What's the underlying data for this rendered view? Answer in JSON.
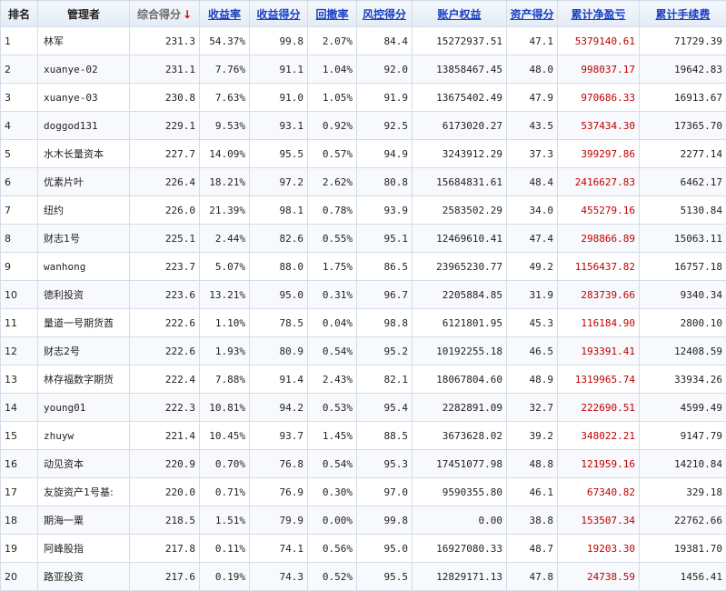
{
  "headers": {
    "rank": "排名",
    "manager": "管理者",
    "score": "综合得分",
    "return_rate": "收益率",
    "return_score": "收益得分",
    "drawdown": "回撤率",
    "risk_score": "风控得分",
    "equity": "账户权益",
    "asset_score": "资产得分",
    "net_pnl": "累计净盈亏",
    "fees": "累计手续费",
    "sort_arrow": "↓"
  },
  "rows": [
    {
      "rank": "1",
      "manager": "林军",
      "score": "231.3",
      "return_rate": "54.37%",
      "return_score": "99.8",
      "drawdown": "2.07%",
      "risk_score": "84.4",
      "equity": "15272937.51",
      "asset_score": "47.1",
      "net_pnl": "5379140.61",
      "fees": "71729.39"
    },
    {
      "rank": "2",
      "manager": "xuanye-02",
      "score": "231.1",
      "return_rate": "7.76%",
      "return_score": "91.1",
      "drawdown": "1.04%",
      "risk_score": "92.0",
      "equity": "13858467.45",
      "asset_score": "48.0",
      "net_pnl": "998037.17",
      "fees": "19642.83"
    },
    {
      "rank": "3",
      "manager": "xuanye-03",
      "score": "230.8",
      "return_rate": "7.63%",
      "return_score": "91.0",
      "drawdown": "1.05%",
      "risk_score": "91.9",
      "equity": "13675402.49",
      "asset_score": "47.9",
      "net_pnl": "970686.33",
      "fees": "16913.67"
    },
    {
      "rank": "4",
      "manager": "doggod131",
      "score": "229.1",
      "return_rate": "9.53%",
      "return_score": "93.1",
      "drawdown": "0.92%",
      "risk_score": "92.5",
      "equity": "6173020.27",
      "asset_score": "43.5",
      "net_pnl": "537434.30",
      "fees": "17365.70"
    },
    {
      "rank": "5",
      "manager": "水木长量资本",
      "score": "227.7",
      "return_rate": "14.09%",
      "return_score": "95.5",
      "drawdown": "0.57%",
      "risk_score": "94.9",
      "equity": "3243912.29",
      "asset_score": "37.3",
      "net_pnl": "399297.86",
      "fees": "2277.14"
    },
    {
      "rank": "6",
      "manager": "优素片叶",
      "score": "226.4",
      "return_rate": "18.21%",
      "return_score": "97.2",
      "drawdown": "2.62%",
      "risk_score": "80.8",
      "equity": "15684831.61",
      "asset_score": "48.4",
      "net_pnl": "2416627.83",
      "fees": "6462.17"
    },
    {
      "rank": "7",
      "manager": "纽约",
      "score": "226.0",
      "return_rate": "21.39%",
      "return_score": "98.1",
      "drawdown": "0.78%",
      "risk_score": "93.9",
      "equity": "2583502.29",
      "asset_score": "34.0",
      "net_pnl": "455279.16",
      "fees": "5130.84"
    },
    {
      "rank": "8",
      "manager": "财志1号",
      "score": "225.1",
      "return_rate": "2.44%",
      "return_score": "82.6",
      "drawdown": "0.55%",
      "risk_score": "95.1",
      "equity": "12469610.41",
      "asset_score": "47.4",
      "net_pnl": "298866.89",
      "fees": "15063.11"
    },
    {
      "rank": "9",
      "manager": "wanhong",
      "score": "223.7",
      "return_rate": "5.07%",
      "return_score": "88.0",
      "drawdown": "1.75%",
      "risk_score": "86.5",
      "equity": "23965230.77",
      "asset_score": "49.2",
      "net_pnl": "1156437.82",
      "fees": "16757.18"
    },
    {
      "rank": "10",
      "manager": "德利投资",
      "score": "223.6",
      "return_rate": "13.21%",
      "return_score": "95.0",
      "drawdown": "0.31%",
      "risk_score": "96.7",
      "equity": "2205884.85",
      "asset_score": "31.9",
      "net_pnl": "283739.66",
      "fees": "9340.34"
    },
    {
      "rank": "11",
      "manager": "量道一号期货酋",
      "score": "222.6",
      "return_rate": "1.10%",
      "return_score": "78.5",
      "drawdown": "0.04%",
      "risk_score": "98.8",
      "equity": "6121801.95",
      "asset_score": "45.3",
      "net_pnl": "116184.90",
      "fees": "2800.10"
    },
    {
      "rank": "12",
      "manager": "财志2号",
      "score": "222.6",
      "return_rate": "1.93%",
      "return_score": "80.9",
      "drawdown": "0.54%",
      "risk_score": "95.2",
      "equity": "10192255.18",
      "asset_score": "46.5",
      "net_pnl": "193391.41",
      "fees": "12408.59"
    },
    {
      "rank": "13",
      "manager": "林存福数字期货",
      "score": "222.4",
      "return_rate": "7.88%",
      "return_score": "91.4",
      "drawdown": "2.43%",
      "risk_score": "82.1",
      "equity": "18067804.60",
      "asset_score": "48.9",
      "net_pnl": "1319965.74",
      "fees": "33934.26"
    },
    {
      "rank": "14",
      "manager": "young01",
      "score": "222.3",
      "return_rate": "10.81%",
      "return_score": "94.2",
      "drawdown": "0.53%",
      "risk_score": "95.4",
      "equity": "2282891.09",
      "asset_score": "32.7",
      "net_pnl": "222690.51",
      "fees": "4599.49"
    },
    {
      "rank": "15",
      "manager": "zhuyw",
      "score": "221.4",
      "return_rate": "10.45%",
      "return_score": "93.7",
      "drawdown": "1.45%",
      "risk_score": "88.5",
      "equity": "3673628.02",
      "asset_score": "39.2",
      "net_pnl": "348022.21",
      "fees": "9147.79"
    },
    {
      "rank": "16",
      "manager": "动见资本",
      "score": "220.9",
      "return_rate": "0.70%",
      "return_score": "76.8",
      "drawdown": "0.54%",
      "risk_score": "95.3",
      "equity": "17451077.98",
      "asset_score": "48.8",
      "net_pnl": "121959.16",
      "fees": "14210.84"
    },
    {
      "rank": "17",
      "manager": "友旋资产1号基:",
      "score": "220.0",
      "return_rate": "0.71%",
      "return_score": "76.9",
      "drawdown": "0.30%",
      "risk_score": "97.0",
      "equity": "9590355.80",
      "asset_score": "46.1",
      "net_pnl": "67340.82",
      "fees": "329.18"
    },
    {
      "rank": "18",
      "manager": "期海一粟",
      "score": "218.5",
      "return_rate": "1.51%",
      "return_score": "79.9",
      "drawdown": "0.00%",
      "risk_score": "99.8",
      "equity": "0.00",
      "asset_score": "38.8",
      "net_pnl": "153507.34",
      "fees": "22762.66"
    },
    {
      "rank": "19",
      "manager": "阿峰股指",
      "score": "217.8",
      "return_rate": "0.11%",
      "return_score": "74.1",
      "drawdown": "0.56%",
      "risk_score": "95.0",
      "equity": "16927080.33",
      "asset_score": "48.7",
      "net_pnl": "19203.30",
      "fees": "19381.70"
    },
    {
      "rank": "20",
      "manager": "路亚投资",
      "score": "217.6",
      "return_rate": "0.19%",
      "return_score": "74.3",
      "drawdown": "0.52%",
      "risk_score": "95.5",
      "equity": "12829171.13",
      "asset_score": "47.8",
      "net_pnl": "24738.59",
      "fees": "1456.41"
    }
  ],
  "colors": {
    "header_link": "#1a3fc4",
    "pnl_red": "#c00000",
    "border": "#d3dde8",
    "sort_arrow": "#d40000"
  }
}
